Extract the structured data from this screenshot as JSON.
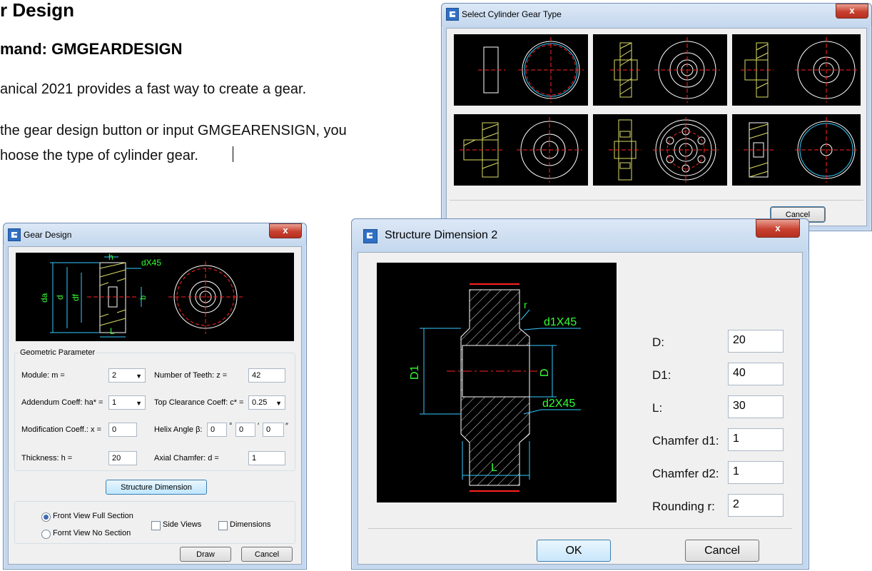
{
  "doc": {
    "heading": "r Design",
    "subheading": "mand: GMGEARDESIGN",
    "line1": "anical 2021 provides a fast way to create a gear.",
    "line2": "the gear design button or input GMGEARENSIGN, you",
    "line3": "hoose the type of cylinder gear."
  },
  "select_dialog": {
    "title": "Select Cylinder Gear Type",
    "close": "x",
    "cancel": "Cancel",
    "gear_types": 6
  },
  "gear_dialog": {
    "title": "Gear Design",
    "close": "x",
    "preview_labels": {
      "h": "h",
      "chamfer": "dX45",
      "da": "da",
      "d": "d",
      "df": "df",
      "b": "b",
      "l": "L"
    },
    "group_title": "Geometric Parameter",
    "module_label": "Module:  m =",
    "module_value": "2",
    "teeth_label": "Number of Teeth:  z =",
    "teeth_value": "42",
    "addendum_label": "Addendum Coeff: ha* =",
    "addendum_value": "1",
    "clearance_label": "Top Clearance Coeff: c* =",
    "clearance_value": "0.25",
    "modification_label": "Modification Coeff.: x =",
    "modification_value": "0",
    "helix_label": "Helix Angle β:",
    "helix_deg": "0",
    "helix_min": "0",
    "helix_sec": "0",
    "deg_symbol": "°",
    "min_symbol": "′",
    "sec_symbol": "″",
    "thickness_label": "Thickness:  h =",
    "thickness_value": "20",
    "axial_label": "Axial Chamfer:  d =",
    "axial_value": "1",
    "structure_button": "Structure Dimension",
    "front_full": "Front View Full Section",
    "front_none": "Fornt View No Section",
    "side_views": "Side Views",
    "dimensions": "Dimensions",
    "draw": "Draw",
    "cancel": "Cancel"
  },
  "structure_dialog": {
    "title": "Structure Dimension 2",
    "close": "x",
    "drawing_labels": {
      "r": "r",
      "d1x45": "d1X45",
      "d2x45": "d2X45",
      "D1": "D1",
      "D": "D",
      "L": "L"
    },
    "fields": [
      {
        "label": "D:",
        "value": "20"
      },
      {
        "label": "D1:",
        "value": "40"
      },
      {
        "label": "L:",
        "value": "30"
      },
      {
        "label": "Chamfer d1:",
        "value": "1"
      },
      {
        "label": "Chamfer d2:",
        "value": "1"
      },
      {
        "label": "Rounding r:",
        "value": "2"
      }
    ],
    "ok": "OK",
    "cancel": "Cancel"
  },
  "colors": {
    "cad_bg": "#000000",
    "cad_line": "#ffffff",
    "cad_center": "#ff2020",
    "cad_dim": "#35d2ff",
    "cad_text": "#33ff33",
    "cad_hatch": "#d7d76a"
  }
}
